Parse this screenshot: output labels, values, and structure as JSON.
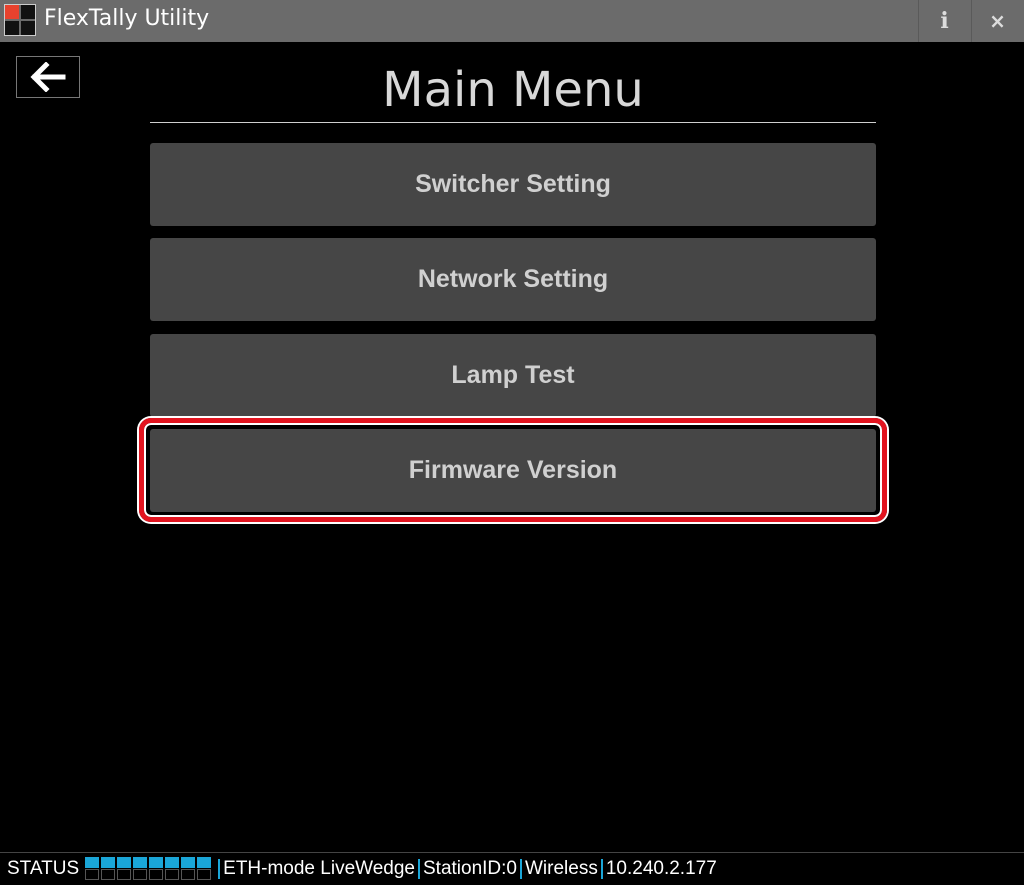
{
  "window": {
    "title": "FlexTally Utility",
    "info_label": "i",
    "close_label": "×"
  },
  "page": {
    "title": "Main Menu"
  },
  "menu": {
    "items": [
      {
        "label": "Switcher Setting"
      },
      {
        "label": "Network Setting"
      },
      {
        "label": "Lamp Test"
      },
      {
        "label": "Firmware Version"
      }
    ],
    "highlighted_index": 3
  },
  "status": {
    "label": "STATUS",
    "led_count": 8,
    "segments": [
      "ETH-mode LiveWedge",
      "StationID:0",
      "Wireless",
      "10.240.2.177"
    ]
  },
  "colors": {
    "accent": "#1aa6d8",
    "highlight": "#e2141f",
    "logo_red": "#e8422e"
  },
  "icons": {
    "back": "arrow-left-icon",
    "logo": "app-logo-icon"
  }
}
